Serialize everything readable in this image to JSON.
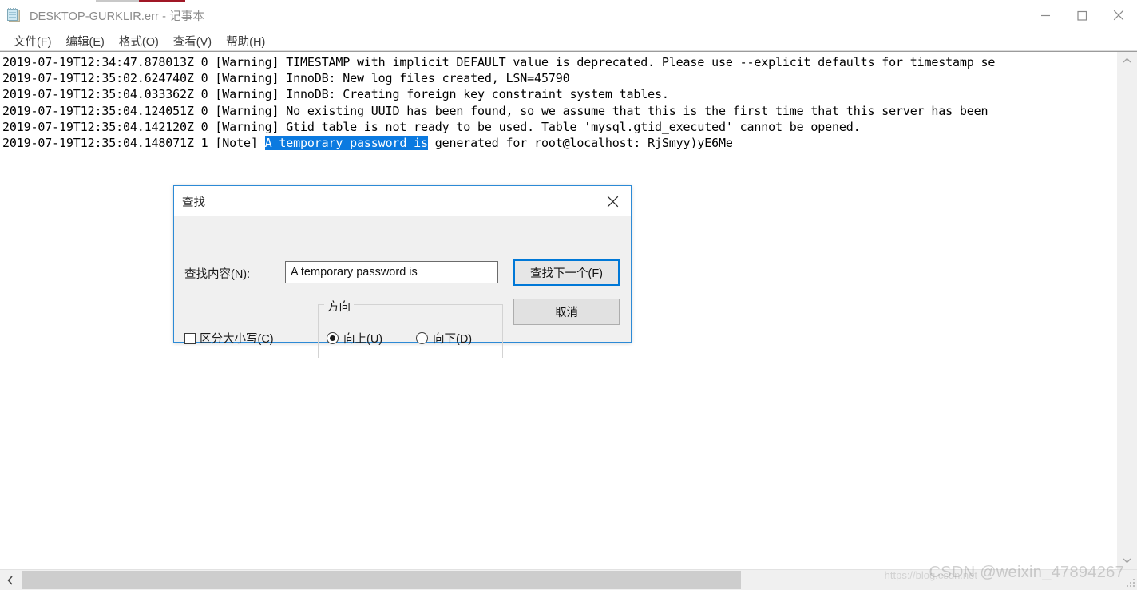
{
  "window": {
    "title": "DESKTOP-GURKLIR.err - 记事本",
    "icon": "notepad-icon",
    "controls": {
      "minimize": "minimize-icon",
      "maximize": "maximize-icon",
      "close": "close-icon"
    }
  },
  "menubar": {
    "items": [
      {
        "label": "文件(F)"
      },
      {
        "label": "编辑(E)"
      },
      {
        "label": "格式(O)"
      },
      {
        "label": "查看(V)"
      },
      {
        "label": "帮助(H)"
      }
    ]
  },
  "editor": {
    "lines": [
      {
        "pre": "2019-07-19T12:34:47.878013Z 0 [Warning] TIMESTAMP with implicit DEFAULT value is deprecated. Please use --explicit_defaults_for_timestamp se",
        "selected": "",
        "post": ""
      },
      {
        "pre": "2019-07-19T12:35:02.624740Z 0 [Warning] InnoDB: New log files created, LSN=45790",
        "selected": "",
        "post": ""
      },
      {
        "pre": "2019-07-19T12:35:04.033362Z 0 [Warning] InnoDB: Creating foreign key constraint system tables.",
        "selected": "",
        "post": ""
      },
      {
        "pre": "2019-07-19T12:35:04.124051Z 0 [Warning] No existing UUID has been found, so we assume that this is the first time that this server has been",
        "selected": "",
        "post": ""
      },
      {
        "pre": "2019-07-19T12:35:04.142120Z 0 [Warning] Gtid table is not ready to be used. Table 'mysql.gtid_executed' cannot be opened.",
        "selected": "",
        "post": ""
      },
      {
        "pre": "2019-07-19T12:35:04.148071Z 1 [Note] ",
        "selected": "A temporary password is",
        "post": " generated for root@localhost: RjSmyy)yE6Me"
      }
    ],
    "selection_color": "#0b7ae0"
  },
  "scrollbars": {
    "vertical_up": "chevron-up-icon",
    "vertical_down": "chevron-down-icon",
    "horizontal_left": "chevron-left-icon"
  },
  "find_dialog": {
    "title": "查找",
    "close_icon": "close-icon",
    "find_what_label": "查找内容(N):",
    "find_what_value": "A temporary password is",
    "find_what_placeholder": "",
    "find_next_label": "查找下一个(F)",
    "cancel_label": "取消",
    "match_case_label": "区分大小写(C)",
    "match_case_checked": false,
    "direction_legend": "方向",
    "direction_up_label": "向上(U)",
    "direction_down_label": "向下(D)",
    "direction_selected": "up",
    "accent_color": "#0078d7"
  },
  "watermark": {
    "text": "CSDN @weixin_47894267",
    "url": "https://blog.csdn.net"
  }
}
